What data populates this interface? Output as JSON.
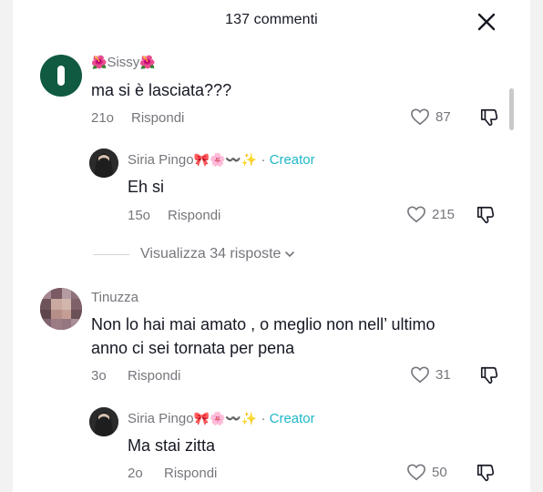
{
  "header": {
    "title": "137 commenti"
  },
  "comments": [
    {
      "username_prefix": "🌺",
      "username": "Sissy",
      "username_suffix": "🌺",
      "text": "ma si è lasciata???",
      "time": "21o",
      "reply_label": "Rispondi",
      "likes": "87"
    },
    {
      "username": "Siria Pingo",
      "username_emojis": "🎀🌸〰️✨",
      "separator": "·",
      "creator_label": "Creator",
      "text": "Eh si",
      "time": "15o",
      "reply_label": "Rispondi",
      "likes": "215"
    },
    {
      "username": "Tinuzza",
      "text_line1": "Non lo hai mai amato , o meglio non nell’ ultimo",
      "text_line2": "anno ci sei tornata per pena",
      "time": "3o",
      "reply_label": "Rispondi",
      "likes": "31"
    },
    {
      "username": "Siria Pingo",
      "username_emojis": "🎀🌸〰️✨",
      "separator": "·",
      "creator_label": "Creator",
      "text": "Ma stai zitta",
      "time": "2o",
      "reply_label": "Rispondi",
      "likes": "50"
    }
  ],
  "view_replies": {
    "label": "Visualizza 34 risposte"
  },
  "colors": {
    "creator": "#20b7c9",
    "muted": "#75767c",
    "avatar_green": "#0f5a40"
  }
}
